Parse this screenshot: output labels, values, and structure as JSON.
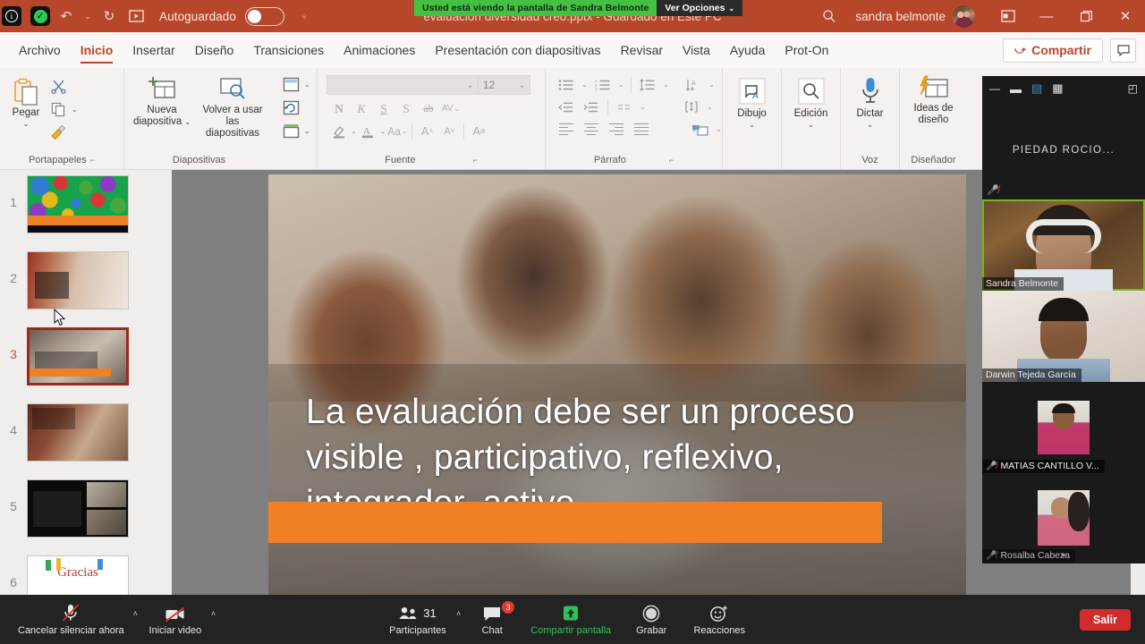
{
  "titlebar": {
    "autosave_label": "Autoguardado",
    "autosave_state": "off",
    "document_title": "evaluación diversidad creo.pptx  -  Guardado en Este PC",
    "user_name": "sandra belmonte",
    "qat": [
      {
        "name": "autosave-info-icon",
        "glyph": "ⓘ"
      },
      {
        "name": "save-icon",
        "glyph": "✓"
      },
      {
        "name": "undo-icon",
        "glyph": "↶"
      },
      {
        "name": "undo-dropdown-icon",
        "glyph": "˅"
      },
      {
        "name": "redo-icon",
        "glyph": "↻"
      },
      {
        "name": "start-presentation-icon",
        "glyph": "▶"
      },
      {
        "name": "qat-customize-icon",
        "glyph": "˅"
      }
    ],
    "window_controls": [
      {
        "name": "search-icon",
        "glyph": "⌕"
      },
      {
        "name": "ribbon-display-options-icon",
        "glyph": "▣"
      },
      {
        "name": "minimize-icon",
        "glyph": "—"
      },
      {
        "name": "restore-icon",
        "glyph": "❐"
      },
      {
        "name": "close-icon",
        "glyph": "✕"
      }
    ]
  },
  "zoom_share_banner": {
    "message": "Usted está viendo la pantalla de Sandra Belmonte",
    "options_label": "Ver Opciones",
    "options_caret": "˅",
    "green": "#44c043"
  },
  "ribbon": {
    "tabs": [
      {
        "label": "Archivo",
        "active": false
      },
      {
        "label": "Inicio",
        "active": true
      },
      {
        "label": "Insertar",
        "active": false
      },
      {
        "label": "Diseño",
        "active": false
      },
      {
        "label": "Transiciones",
        "active": false
      },
      {
        "label": "Animaciones",
        "active": false
      },
      {
        "label": "Presentación con diapositivas",
        "active": false
      },
      {
        "label": "Revisar",
        "active": false
      },
      {
        "label": "Vista",
        "active": false
      },
      {
        "label": "Ayuda",
        "active": false
      },
      {
        "label": "Prot-On",
        "active": false
      }
    ],
    "share_label": "Compartir",
    "groups": {
      "clipboard": {
        "label": "Portapapeles",
        "paste_label": "Pegar",
        "cut_label": "✂",
        "copy_label": "⧉",
        "format_painter_label": "🖌",
        "dialog_launcher": "⤵"
      },
      "slides": {
        "label": "Diapositivas",
        "new_slide_line1": "Nueva",
        "new_slide_line2": "diapositiva",
        "reuse_line1": "Volver a usar",
        "reuse_line2": "las diapositivas",
        "layout_icon": "layout-icon",
        "reset_icon": "reset-icon",
        "section_icon": "section-icon"
      },
      "font": {
        "label": "Fuente",
        "font_name_value": "",
        "font_size_value": "12",
        "bold": "N",
        "italic": "K",
        "underline": "S",
        "shadow": "S",
        "strikethrough": "ab",
        "char_spacing": "AV",
        "change_case": "Aa",
        "increase_size": "A",
        "decrease_size": "A",
        "clear_format": "A",
        "dialog_launcher": "⤵"
      },
      "paragraph": {
        "label": "Párrafo",
        "dialog_launcher": "⤵"
      },
      "drawing": {
        "label": "Dibujo",
        "caret": "˅"
      },
      "editing": {
        "label": "Edición",
        "caret": "˅"
      },
      "voice": {
        "label": "Voz",
        "dictate_label": "Dictar",
        "caret": "˅"
      },
      "designer": {
        "label": "Diseñador",
        "ideas_line1": "Ideas de",
        "ideas_line2": "diseño"
      }
    }
  },
  "slides_panel": {
    "slides": [
      {
        "number": "1",
        "selected": false,
        "kind": "colorful-shapes"
      },
      {
        "number": "2",
        "selected": false,
        "kind": "child-writing"
      },
      {
        "number": "3",
        "selected": true,
        "kind": "children-hands"
      },
      {
        "number": "4",
        "selected": false,
        "kind": "child-reading"
      },
      {
        "number": "5",
        "selected": false,
        "kind": "dark-text-slide"
      },
      {
        "number": "6",
        "selected": false,
        "kind": "gracias",
        "text": "Gracias"
      }
    ]
  },
  "slide": {
    "body_text": "La evaluación  debe ser un proceso visible , participativo, reflexivo, integrador, activo",
    "accent_bar_color": "#f08026"
  },
  "zoom_panel": {
    "toolbar": [
      {
        "name": "minimize-icon",
        "glyph": "—"
      },
      {
        "name": "speaker-view-icon",
        "glyph": "▬"
      },
      {
        "name": "gallery-split-icon",
        "glyph": "⌸"
      },
      {
        "name": "grid-view-icon",
        "glyph": "☰"
      },
      {
        "name": "expand-panel-icon",
        "glyph": "◰"
      }
    ],
    "participants": [
      {
        "name": "PIEDAD ROCIO...",
        "video": false,
        "muted": true,
        "active": false
      },
      {
        "name": "Sandra Belmonte",
        "video": true,
        "muted": false,
        "active": true
      },
      {
        "name": "Darwin Tejeda García",
        "video": true,
        "muted": false,
        "active": false
      },
      {
        "name": "MATIAS CANTILLO V...",
        "video": true,
        "muted": true,
        "active": false
      },
      {
        "name": "Rosalba Cabeza",
        "video": true,
        "muted": true,
        "active": false
      }
    ],
    "scroll_more_icon": "chevron-down-icon"
  },
  "zoom_toolbar": {
    "mute": {
      "label": "Cancelar silenciar ahora",
      "icon": "microphone-muted-icon",
      "caret": "˄"
    },
    "video": {
      "label": "Iniciar video",
      "icon": "camera-off-icon",
      "caret": "˄"
    },
    "participants": {
      "label": "Participantes",
      "count": "31",
      "icon": "people-icon",
      "caret": "˄"
    },
    "chat": {
      "label": "Chat",
      "badge": "3",
      "icon": "chat-bubble-icon"
    },
    "share": {
      "label": "Compartir pantalla",
      "icon": "share-screen-icon",
      "color": "#2fc25b"
    },
    "record": {
      "label": "Grabar",
      "icon": "record-circle-icon"
    },
    "reactions": {
      "label": "Reacciones",
      "icon": "smiley-plus-icon"
    },
    "leave": {
      "label": "Salir",
      "color": "#d32b2b"
    }
  }
}
